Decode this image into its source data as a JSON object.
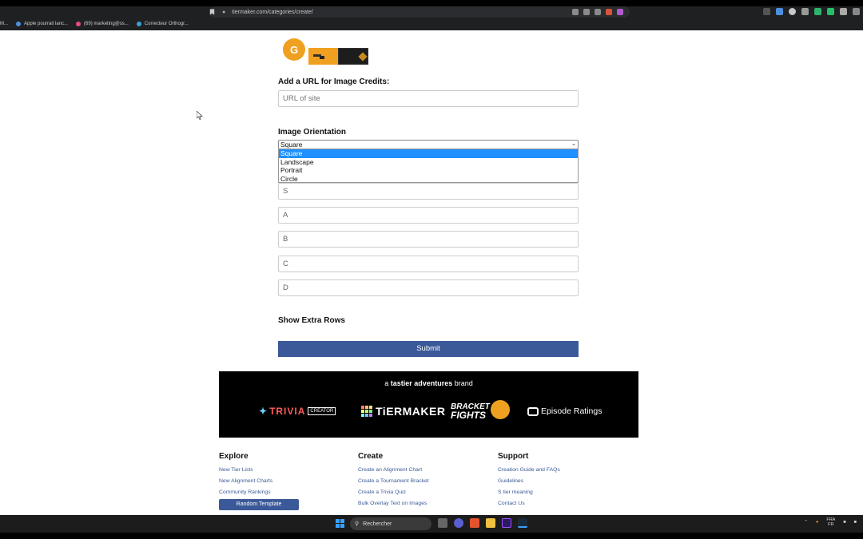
{
  "browser": {
    "url": "tiermaker.com/categories/create/",
    "bookmarks": [
      {
        "label": "M...",
        "color": "#999999"
      },
      {
        "label": "Apple pourrait lanc...",
        "color": "#4a90e2"
      },
      {
        "label": "(69) marketing@ss...",
        "color": "#e84c7c"
      },
      {
        "label": "Correcteur Orthogr...",
        "color": "#3aa0d8"
      }
    ]
  },
  "form": {
    "avatar_letter": "G",
    "image_credits_label": "Add a URL for Image Credits:",
    "url_placeholder": "URL of site",
    "orientation_label": "Image Orientation",
    "orientation_selected": "Square",
    "orientation_options": [
      "Square",
      "Landscape",
      "Portrait",
      "Circle"
    ],
    "tier_rows": [
      "S",
      "A",
      "B",
      "C",
      "D"
    ],
    "show_extra_rows": "Show Extra Rows",
    "submit": "Submit"
  },
  "brand_bar": {
    "tagline_prefix": "a ",
    "tagline_bold": "tastier adventures",
    "tagline_suffix": " brand",
    "trivia": "TRIVIA",
    "trivia_sub": "CREATOR",
    "tiermaker": "TiERMAKER",
    "bracket_top": "BRACKET",
    "bracket_bottom": "FIGHTS",
    "episode": "Episode Ratings"
  },
  "footer": {
    "explore": {
      "title": "Explore",
      "links": [
        "New Tier Lists",
        "New Alignment Charts",
        "Community Rankings"
      ],
      "button": "Random Template"
    },
    "create": {
      "title": "Create",
      "links": [
        "Create an Alignment Chart",
        "Create a Tournament Bracket",
        "Create a Trivia Quiz",
        "Bulk Overlay Text on Images"
      ]
    },
    "support": {
      "title": "Support",
      "links": [
        "Creation Guide and FAQs",
        "Guidelines",
        "S tier meaning",
        "Contact Us"
      ]
    }
  },
  "taskbar": {
    "search": "Rechercher",
    "lang_top": "FRA",
    "lang_bottom": "FR"
  }
}
